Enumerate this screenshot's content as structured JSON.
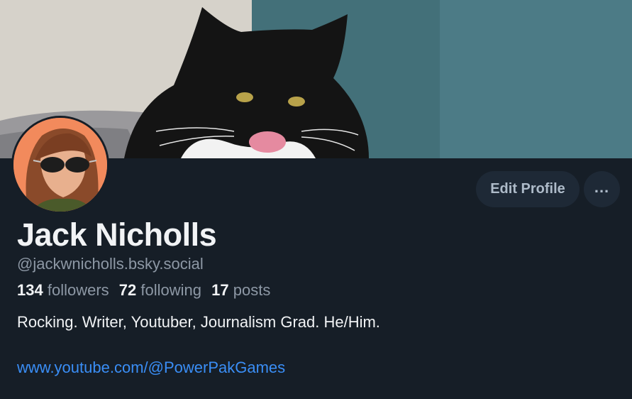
{
  "profile": {
    "display_name": "Jack Nicholls",
    "handle": "@jackwnicholls.bsky.social",
    "stats": {
      "followers_count": "134",
      "followers_label": "followers",
      "following_count": "72",
      "following_label": "following",
      "posts_count": "17",
      "posts_label": "posts"
    },
    "bio": "Rocking. Writer, Youtuber, Journalism Grad. He/Him.",
    "link": "www.youtube.com/@PowerPakGames"
  },
  "actions": {
    "edit_profile_label": "Edit Profile",
    "more_label": "..."
  },
  "colors": {
    "background": "#161e27",
    "button_bg": "#1e2936",
    "link": "#3a8ef6",
    "muted_text": "#8d98a5"
  }
}
